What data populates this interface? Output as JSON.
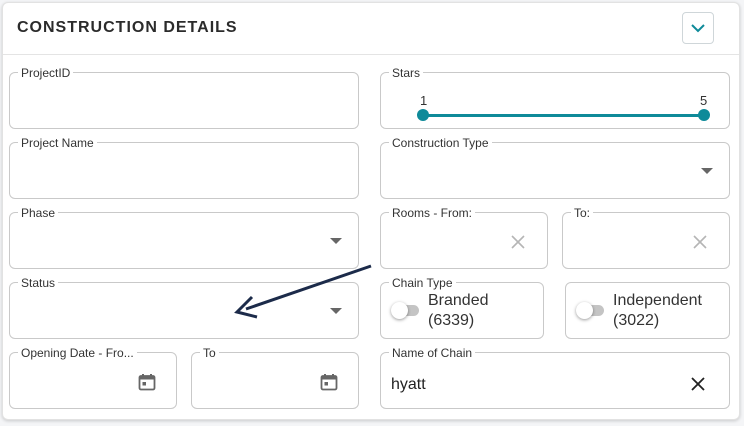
{
  "section": {
    "title": "CONSTRUCTION DETAILS",
    "collapse_icon": "chevron-down-icon"
  },
  "fields": {
    "project_id": {
      "label": "ProjectID",
      "value": ""
    },
    "stars": {
      "label": "Stars",
      "min_value": "1",
      "max_value": "5",
      "range": [
        1,
        5
      ]
    },
    "project_name": {
      "label": "Project Name",
      "value": ""
    },
    "construction_type": {
      "label": "Construction Type",
      "value": ""
    },
    "phase": {
      "label": "Phase",
      "value": ""
    },
    "rooms_from": {
      "label": "Rooms - From:",
      "value": ""
    },
    "rooms_to": {
      "label": "To:",
      "value": ""
    },
    "status": {
      "label": "Status",
      "value": ""
    },
    "chain_type": {
      "label": "Chain Type",
      "options": [
        {
          "label": "Branded",
          "count": "(6339)",
          "on": false
        },
        {
          "label": "Independent",
          "count": "(3022)",
          "on": false
        }
      ]
    },
    "opening_date_from": {
      "label": "Opening Date - Fro...",
      "value": ""
    },
    "opening_date_to": {
      "label": "To",
      "value": ""
    },
    "name_of_chain": {
      "label": "Name of Chain",
      "value": "hyatt"
    }
  },
  "colors": {
    "accent": "#0e8a99",
    "annotation_arrow": "#1c2b4a",
    "border": "#c9c9c9"
  }
}
